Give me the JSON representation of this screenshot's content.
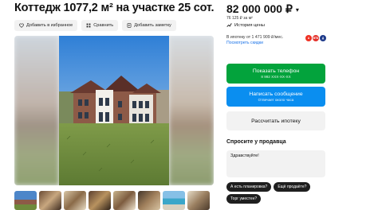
{
  "listing": {
    "title": "Коттедж 1077,2 м² на участке 25 сот.",
    "actions": [
      {
        "label": "Добавить в избранное",
        "icon": "heart-icon"
      },
      {
        "label": "Сравнить",
        "icon": "compare-icon"
      },
      {
        "label": "Добавить заметку",
        "icon": "note-icon"
      }
    ],
    "thumbnails_count": 8
  },
  "sidebar": {
    "price": "82 000 000 ₽",
    "price_per_sqm": "76 125 ₽ за м²",
    "price_history_label": "История цены",
    "mortgage_text": "В ипотеку от 1 471 909 ₽/мес.",
    "discounts_link": "Посмотреть скидки",
    "banks": [
      {
        "label": "А",
        "color": "#ef3124"
      },
      {
        "label": "ВТБ",
        "color": "#e4322b"
      },
      {
        "label": "Д",
        "color": "#1e3a8a"
      }
    ],
    "show_phone": {
      "label": "Показать телефон",
      "sub": "8 992 XXX-XX-XX"
    },
    "message": {
      "label": "Написать сообщение",
      "sub": "Отвечает около часа"
    },
    "mortgage_button": "Рассчитать ипотеку",
    "ask_title": "Спросите у продавца",
    "ask_value": "Здравствуйте!",
    "quick_questions": [
      "А есть планировка?",
      "Ещё продаёте?",
      "Торг уместен?"
    ]
  },
  "colors": {
    "phone_button": "#03a33c",
    "message_button": "#0a8ef0",
    "link": "#1a73e8",
    "chip_dark": "#1f1f1f"
  }
}
